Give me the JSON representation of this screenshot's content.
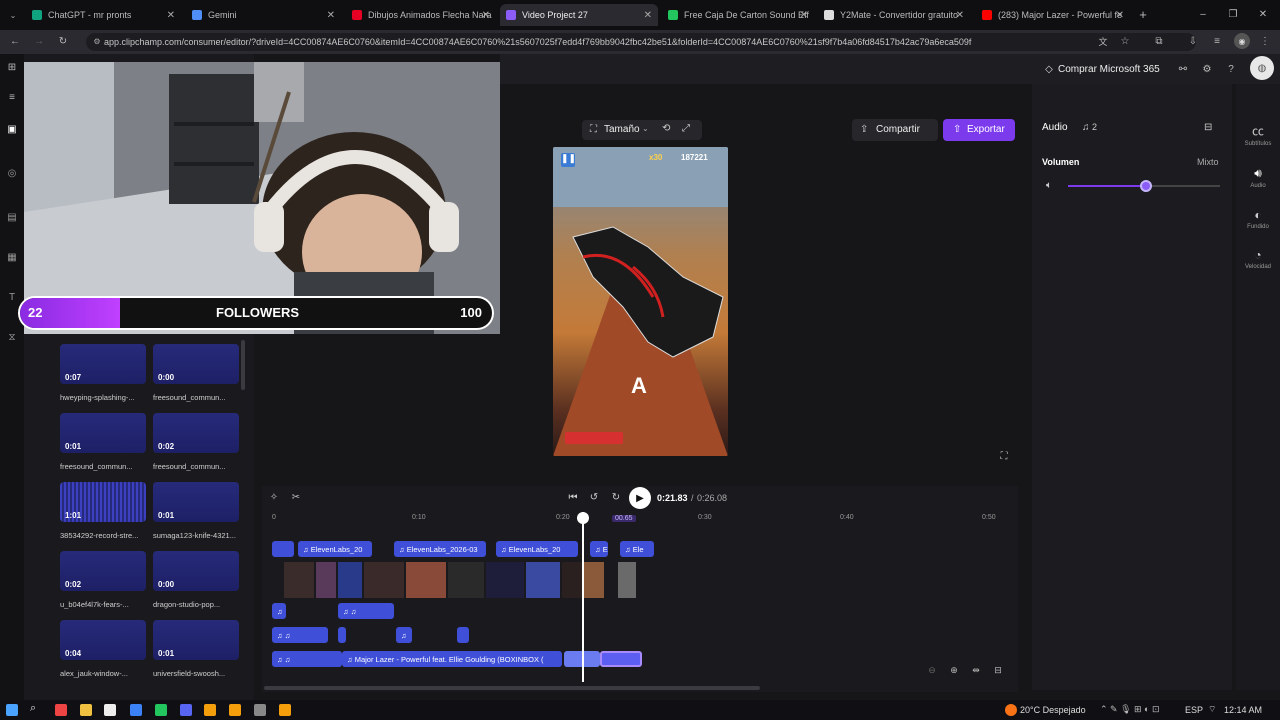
{
  "browser": {
    "tabs": [
      {
        "label": "ChatGPT - mr pronts",
        "color": "#10a37f"
      },
      {
        "label": "Gemini",
        "color": "#4f8ef7"
      },
      {
        "label": "Dibujos Animados Flecha Nara",
        "color": "#e60023"
      },
      {
        "label": "Video Project 27",
        "color": "#8b5cf6"
      },
      {
        "label": "Free Caja De Carton Sound Eff",
        "color": "#22c55e"
      },
      {
        "label": "Y2Mate - Convertidor gratuito",
        "color": "#dddddd"
      },
      {
        "label": "(283) Major Lazer - Powerful fe",
        "color": "#ff0000"
      }
    ],
    "url": "app.clipchamp.com/consumer/editor/?driveId=4CC00874AE6C0760&itemId=4CC00874AE6C0760%21s5607025f7edd4f769bb9042fbc42be51&folderId=4CC00874AE6C0760%21sf9f7b4a06fd84517b42ac79a6eca509f"
  },
  "overlay": {
    "followers_current": "22",
    "followers_label": "FOLLOWERS",
    "followers_goal": "100",
    "progress_fraction": 0.22
  },
  "media": [
    {
      "dur": "0:07",
      "name": "hweyping-splashing-..."
    },
    {
      "dur": "0:00",
      "name": "freesound_commun..."
    },
    {
      "dur": "0:01",
      "name": "freesound_commun..."
    },
    {
      "dur": "0:02",
      "name": "freesound_commun..."
    },
    {
      "dur": "1:01",
      "name": "38534292-record-stre..."
    },
    {
      "dur": "0:01",
      "name": "sumaga123-knife-4321..."
    },
    {
      "dur": "0:02",
      "name": "u_b04ef4l7k-fears-..."
    },
    {
      "dur": "0:00",
      "name": "dragon-studio-pop..."
    },
    {
      "dur": "0:04",
      "name": "alex_jauk-window-..."
    },
    {
      "dur": "0:01",
      "name": "universfield-swoosh..."
    }
  ],
  "toolbar": {
    "size_label": "Tamaño",
    "share_label": "Compartir",
    "export_label": "Exportar",
    "ms365_label": "Comprar Microsoft 365"
  },
  "preview": {
    "score": "187221",
    "multiplier": "x30",
    "letter": "A"
  },
  "player": {
    "current": "0:21.83",
    "separator": "/",
    "total": "0:26.08"
  },
  "ruler": {
    "ticks": [
      "0",
      "0:10",
      "0:20",
      "0:30",
      "0:40",
      "0:50"
    ],
    "marker": "00.65"
  },
  "tracks": {
    "audio1": [
      "ElevenLabs_20",
      "ElevenLabs_2026-03",
      "ElevenLabs_20",
      "Ele",
      "Ele"
    ],
    "music": "Major Lazer - Powerful feat. Ellie Goulding (BOXINBOX ("
  },
  "right_panel": {
    "tab_audio": "Audio",
    "tab_count": "2",
    "volume_label": "Volumen",
    "mix_label": "Mixto",
    "volume_fraction": 0.51
  },
  "right_rail": [
    "Subtítulos",
    "Audio",
    "Fundido",
    "Velocidad"
  ],
  "taskbar": {
    "weather": "20°C Despejado",
    "lang": "ESP",
    "time": "12:14 AM"
  }
}
